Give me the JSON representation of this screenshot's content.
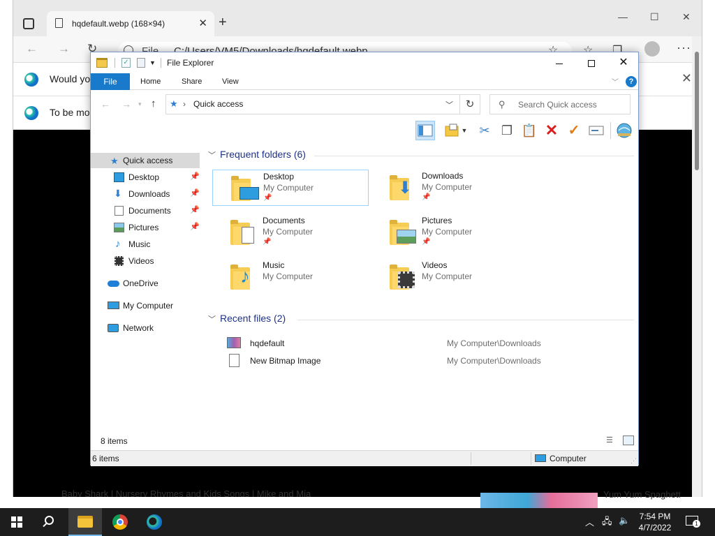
{
  "browser": {
    "tab_title": "hqdefault.webp (168×94)",
    "url_scheme": "File",
    "url": "C:/Users/VM5/Downloads/hqdefault.webp",
    "infobar1_text": "Would you",
    "infobar2_text": "To be mos",
    "page_text_left": "Baby Shark | Nursery Rhymes and Kids Songs | Mike and Mia",
    "page_text_right": "Yum Yum Spaghetti |"
  },
  "explorer": {
    "title": "File Explorer",
    "ribbon_tabs": [
      "File",
      "Home",
      "Share",
      "View"
    ],
    "address": "Quick access",
    "search_placeholder": "Search Quick access",
    "sidebar": [
      {
        "label": "Quick access",
        "icon": "star-icon",
        "pinned": false,
        "selected": true
      },
      {
        "label": "Desktop",
        "icon": "desktop-icon",
        "pinned": true
      },
      {
        "label": "Downloads",
        "icon": "download-icon",
        "pinned": true
      },
      {
        "label": "Documents",
        "icon": "documents-icon",
        "pinned": true
      },
      {
        "label": "Pictures",
        "icon": "pictures-icon",
        "pinned": true
      },
      {
        "label": "Music",
        "icon": "music-icon",
        "pinned": false
      },
      {
        "label": "Videos",
        "icon": "videos-icon",
        "pinned": false
      },
      {
        "label": "OneDrive",
        "icon": "onedrive-icon",
        "pinned": false
      },
      {
        "label": "My Computer",
        "icon": "computer-icon",
        "pinned": false
      },
      {
        "label": "Network",
        "icon": "network-icon",
        "pinned": false
      }
    ],
    "frequent_header": "Frequent folders (6)",
    "frequent": [
      {
        "name": "Desktop",
        "location": "My Computer",
        "pinned": true
      },
      {
        "name": "Downloads",
        "location": "My Computer",
        "pinned": true
      },
      {
        "name": "Documents",
        "location": "My Computer",
        "pinned": true
      },
      {
        "name": "Pictures",
        "location": "My Computer",
        "pinned": true
      },
      {
        "name": "Music",
        "location": "My Computer",
        "pinned": false
      },
      {
        "name": "Videos",
        "location": "My Computer",
        "pinned": false
      }
    ],
    "recent_header": "Recent files (2)",
    "recent": [
      {
        "name": "hqdefault",
        "location": "My Computer\\Downloads"
      },
      {
        "name": "New Bitmap Image",
        "location": "My Computer\\Downloads"
      }
    ],
    "status_items": "8 items",
    "status_bottom_left": "6 items",
    "status_bottom_right": "Computer"
  },
  "taskbar": {
    "time": "7:54 PM",
    "date": "4/7/2022",
    "notification_count": "1"
  },
  "colors": {
    "accent": "#1979ca",
    "group_header": "#1e3287",
    "selection": "#cce4f7"
  }
}
